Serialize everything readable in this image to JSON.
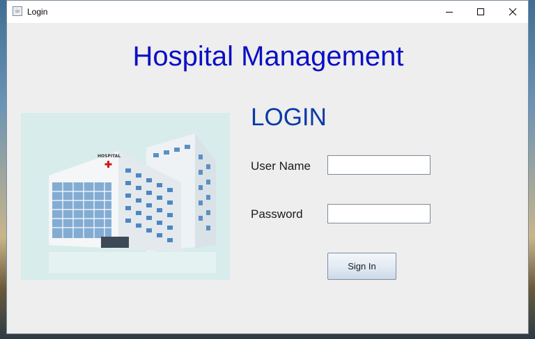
{
  "window": {
    "title": "Login",
    "app_icon": "java-cup-icon",
    "controls": [
      "minimize-icon",
      "maximize-icon",
      "close-icon"
    ]
  },
  "main": {
    "heading": "Hospital Management",
    "image": {
      "icon": "hospital-building-image",
      "sign_text": "HOSPITAL"
    },
    "login_title": "LOGIN",
    "username": {
      "label": "User Name",
      "value": ""
    },
    "password": {
      "label": "Password",
      "value": ""
    },
    "signin_label": "Sign In"
  },
  "colors": {
    "heading": "#0b0fc4",
    "login_title": "#0a3aa6",
    "background": "#eeeeee"
  }
}
